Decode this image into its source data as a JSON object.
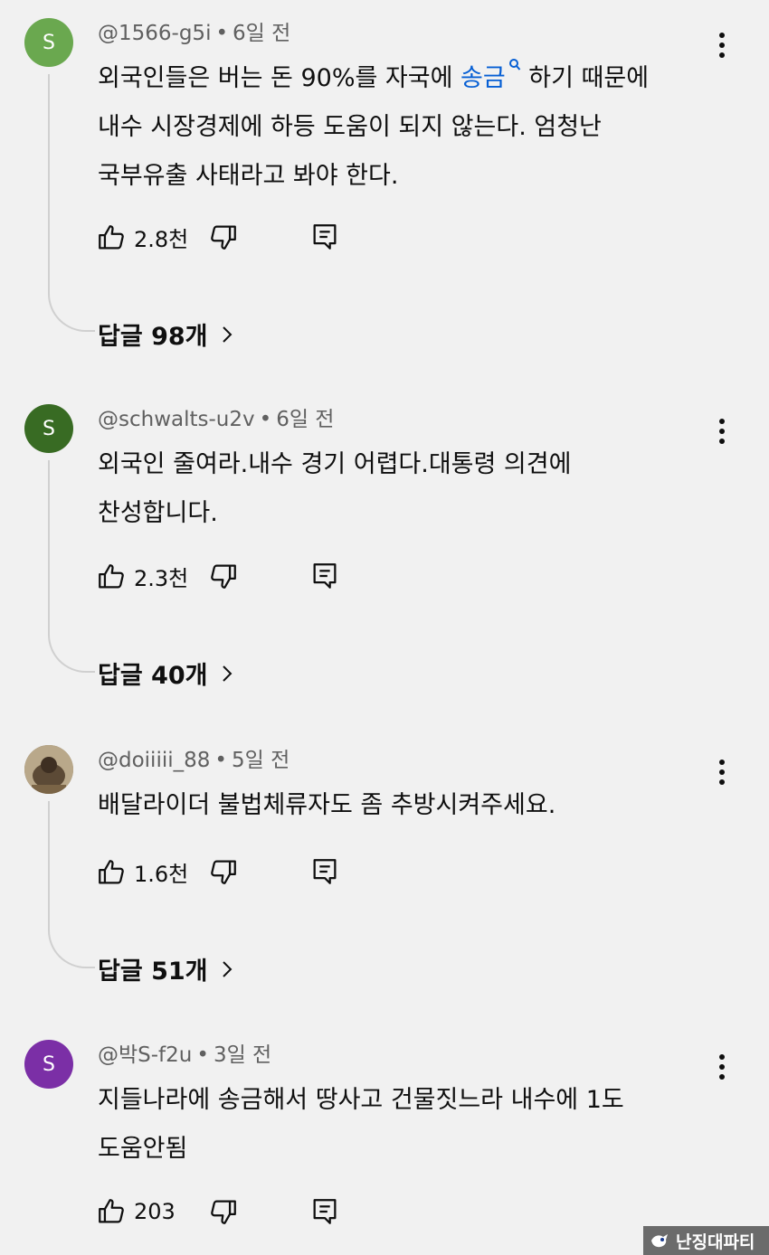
{
  "colors": {
    "background": "#f1f1f1",
    "link": "#065fd4",
    "meta_text": "#606060",
    "thread_line": "#d0d0d0"
  },
  "comments": [
    {
      "avatar_letter": "S",
      "avatar_color": "#6aa84f",
      "author": "@1566-g5i",
      "separator": "•",
      "time": "6일 전",
      "lines": [
        {
          "before": "외국인들은 버는 돈 90%를 자국에 ",
          "link": "송금",
          "after": " 하기 때문에"
        },
        {
          "before": "내수 시장경제에 하등 도움이 되지 않는다. 엄청난"
        },
        {
          "before": "국부유출 사태라고 봐야 한다."
        }
      ],
      "likes": "2.8천",
      "replies_label": "답글 98개"
    },
    {
      "avatar_letter": "S",
      "avatar_color": "#386b23",
      "author": "@schwalts-u2v",
      "separator": "•",
      "time": "6일 전",
      "lines": [
        {
          "before": "외국인 줄여라.내수 경기 어렵다.대통령 의견에"
        },
        {
          "before": "찬성합니다."
        }
      ],
      "likes": "2.3천",
      "replies_label": "답글 40개"
    },
    {
      "avatar_letter": "",
      "avatar_color": "#8a7a60",
      "author": "@doiiiii_88",
      "separator": "•",
      "time": "5일 전",
      "lines": [
        {
          "before": "배달라이더 불법체류자도 좀 추방시켜주세요."
        }
      ],
      "likes": "1.6천",
      "replies_label": "답글 51개"
    },
    {
      "avatar_letter": "S",
      "avatar_color": "#7b2fa6",
      "author": "@박S-f2u",
      "separator": "•",
      "time": "3일 전",
      "lines": [
        {
          "before": "지들나라에 송금해서 땅사고 건물짓느라 내수에 1도"
        },
        {
          "before": "도움안됨"
        }
      ],
      "likes": "203"
    }
  ],
  "watermark": "난징대파티",
  "icons": {
    "more": "more-vert-icon",
    "like": "thumbs-up-icon",
    "dislike": "thumbs-down-icon",
    "reply": "reply-comment-icon",
    "chevron": "chevron-right-icon",
    "search": "search-icon"
  }
}
